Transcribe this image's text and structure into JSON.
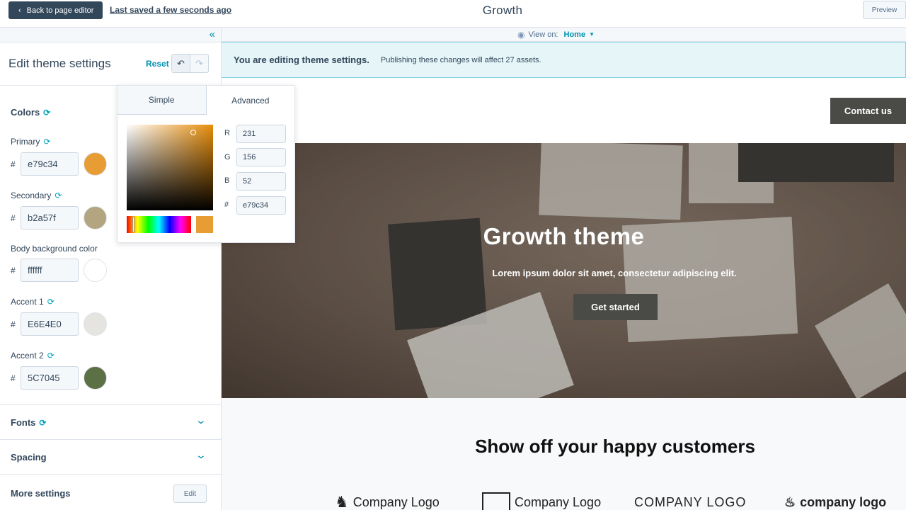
{
  "topbar": {
    "back_label": "Back to page editor",
    "saved_text": "Last saved a few seconds ago",
    "page_name": "Growth",
    "preview_label": "Preview"
  },
  "sidebar": {
    "title": "Edit theme settings",
    "reset_label": "Reset",
    "colors_title": "Colors",
    "colors": [
      {
        "label": "Primary",
        "hex": "e79c34",
        "swatch": "#e79c34"
      },
      {
        "label": "Secondary",
        "hex": "b2a57f",
        "swatch": "#b2a57f"
      },
      {
        "label": "Body background color",
        "hex": "ffffff",
        "swatch": "#ffffff"
      },
      {
        "label": "Accent 1",
        "hex": "E6E4E0",
        "swatch": "#e6e4e0"
      },
      {
        "label": "Accent 2",
        "hex": "5C7045",
        "swatch": "#5c7045"
      }
    ],
    "hash": "#",
    "fonts_title": "Fonts",
    "spacing_title": "Spacing",
    "more_title": "More settings",
    "edit_label": "Edit"
  },
  "picker": {
    "tab_simple": "Simple",
    "tab_advanced": "Advanced",
    "r_label": "R",
    "r_value": "231",
    "g_label": "G",
    "g_value": "156",
    "b_label": "B",
    "b_value": "52",
    "hex_label": "#",
    "hex_value": "e79c34",
    "preview_color": "#e79c34"
  },
  "main": {
    "view_on_label": "View on:",
    "view_on_value": "Home",
    "notice_strong": "You are editing theme settings.",
    "notice_text": "Publishing these changes will affect 27 assets.",
    "contact_label": "Contact us",
    "hero_title": "Growth theme",
    "hero_subtitle": "Lorem ipsum dolor sit amet, consectetur adipiscing elit.",
    "hero_button": "Get started",
    "customers_title": "Show off your happy customers",
    "logos": [
      "Company Logo",
      "Company Logo",
      "COMPANY LOGO",
      "company logo"
    ]
  }
}
